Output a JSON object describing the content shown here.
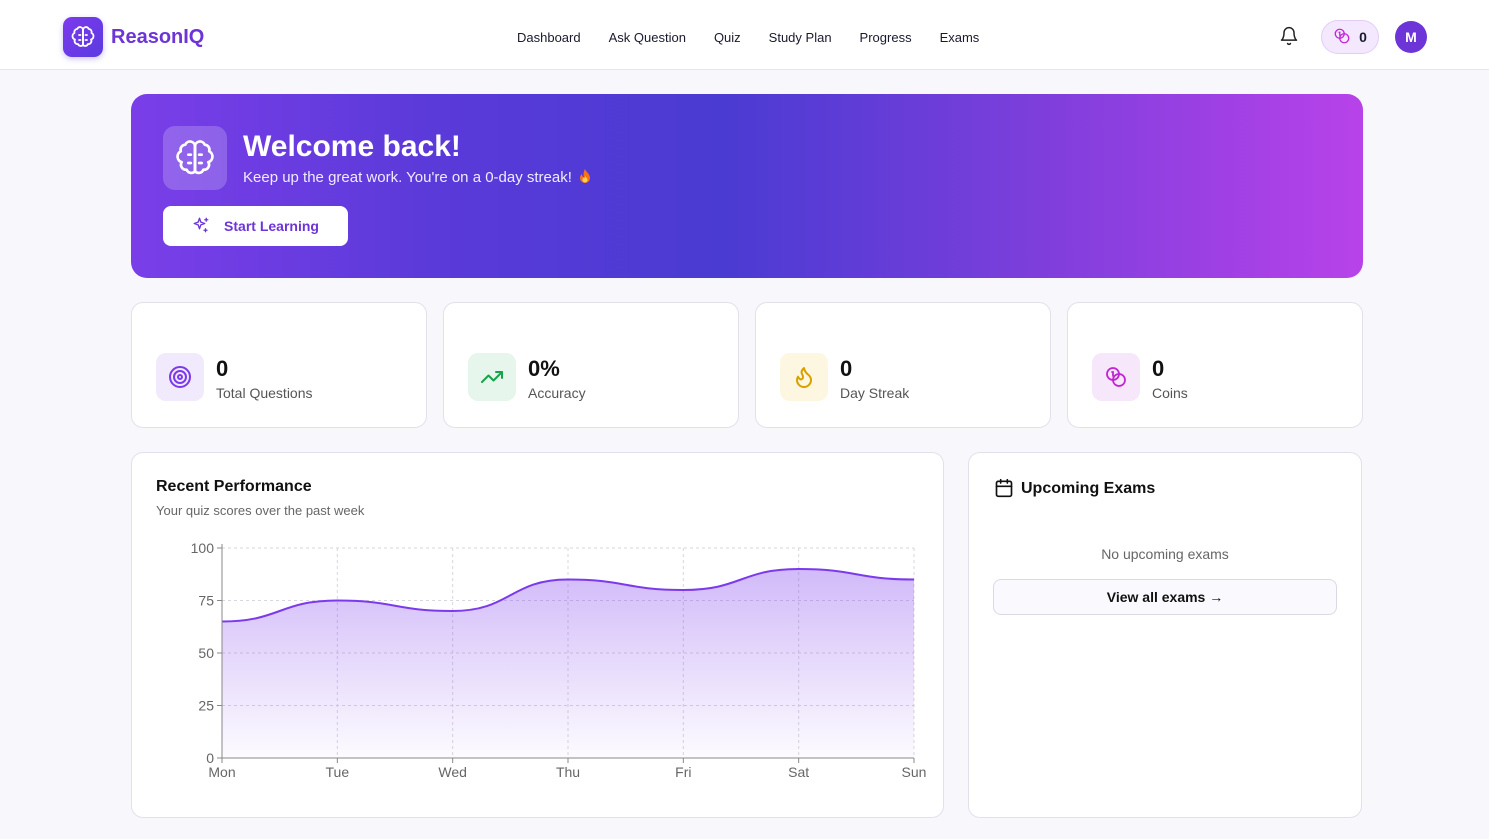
{
  "app": {
    "brand": "ReasonIQ"
  },
  "nav": {
    "items": [
      {
        "label": "Dashboard"
      },
      {
        "label": "Ask Question"
      },
      {
        "label": "Quiz"
      },
      {
        "label": "Study Plan"
      },
      {
        "label": "Progress"
      },
      {
        "label": "Exams"
      }
    ]
  },
  "header": {
    "coins": "0",
    "avatar_initial": "M"
  },
  "hero": {
    "title": "Welcome back!",
    "subtitle": "Keep up the great work. You're on a 0-day streak!",
    "button_label": "Start Learning"
  },
  "stats": [
    {
      "value": "0",
      "label": "Total Questions",
      "icon": "target-icon"
    },
    {
      "value": "0%",
      "label": "Accuracy",
      "icon": "trending-up-icon"
    },
    {
      "value": "0",
      "label": "Day Streak",
      "icon": "flame-icon"
    },
    {
      "value": "0",
      "label": "Coins",
      "icon": "coins-icon"
    }
  ],
  "performance": {
    "title": "Recent Performance",
    "subtitle": "Your quiz scores over the past week"
  },
  "exams": {
    "title": "Upcoming Exams",
    "empty_text": "No upcoming exams",
    "button_label": "View all exams →"
  },
  "colors": {
    "brand": "#6d35d8",
    "line": "#7c3aed",
    "green": "#16a34a",
    "amber": "#d9a100",
    "pink": "#c026d3"
  },
  "chart_data": {
    "type": "area",
    "categories": [
      "Mon",
      "Tue",
      "Wed",
      "Thu",
      "Fri",
      "Sat",
      "Sun"
    ],
    "values": [
      65,
      75,
      70,
      85,
      80,
      90,
      85
    ],
    "ylim": [
      0,
      100
    ],
    "yticks": [
      0,
      25,
      50,
      75,
      100
    ],
    "grid": true
  }
}
